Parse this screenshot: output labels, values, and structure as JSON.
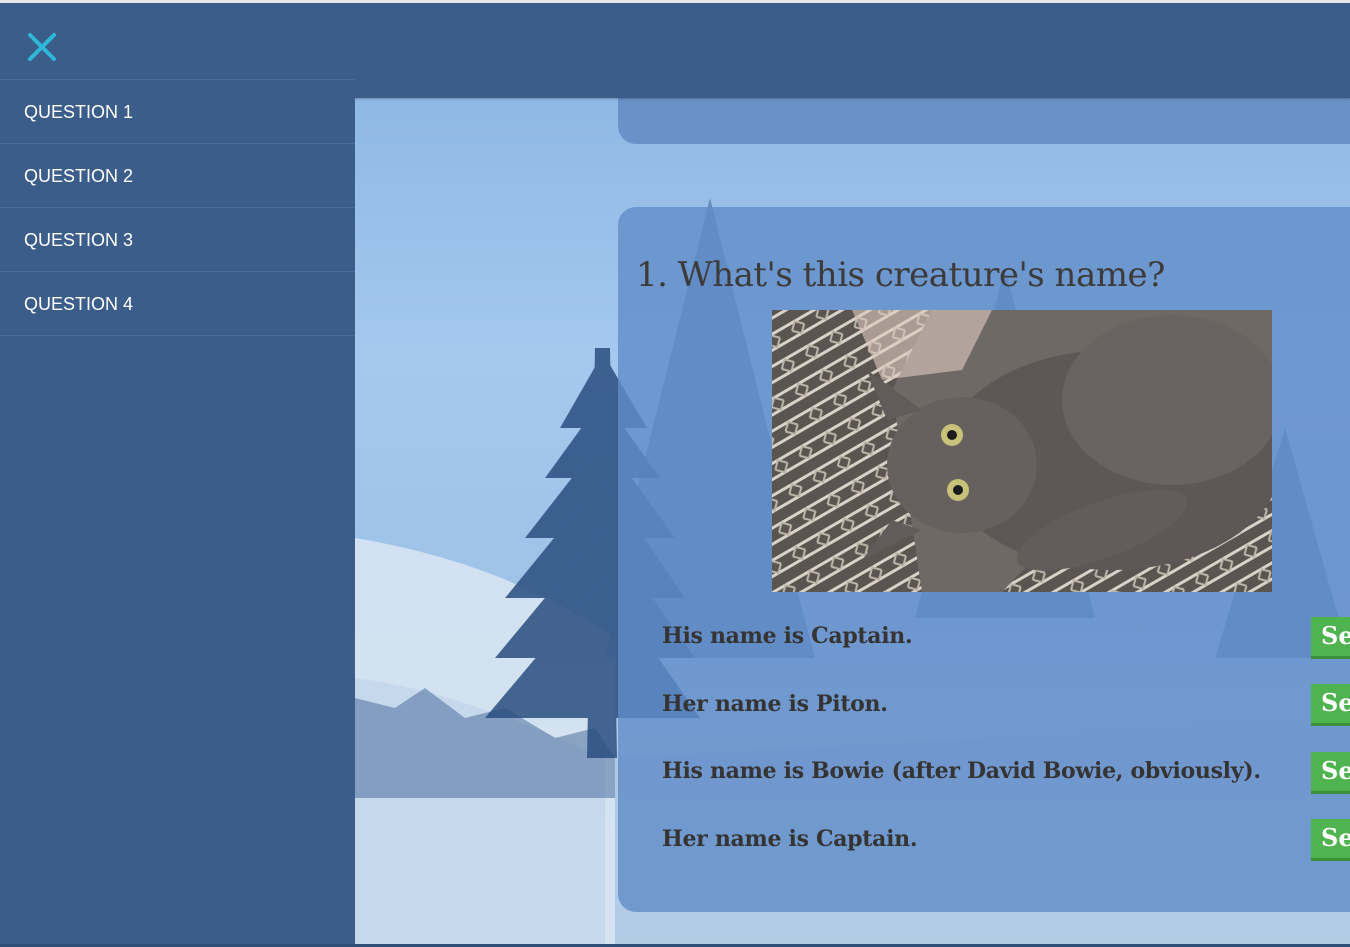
{
  "nav": {
    "close_icon": "close-icon",
    "accent_color": "#2fb7d8",
    "items": [
      {
        "label": "QUESTION 1"
      },
      {
        "label": "QUESTION 2"
      },
      {
        "label": "QUESTION 3"
      },
      {
        "label": "QUESTION 4"
      }
    ]
  },
  "question": {
    "title": "1. What's this creature's name?",
    "image": "cat-photo",
    "answers": [
      {
        "text": "His name is Captain.",
        "button_label": "Select"
      },
      {
        "text": "Her name is Piton.",
        "button_label": "Select"
      },
      {
        "text": "His name is Bowie (after David Bowie, obviously).",
        "button_label": "Select"
      },
      {
        "text": "Her name is Captain.",
        "button_label": "Select"
      }
    ]
  },
  "colors": {
    "panel": "#3b5d8a",
    "card": "#6892c8",
    "button": "#4fb34f",
    "text": "#353433"
  }
}
